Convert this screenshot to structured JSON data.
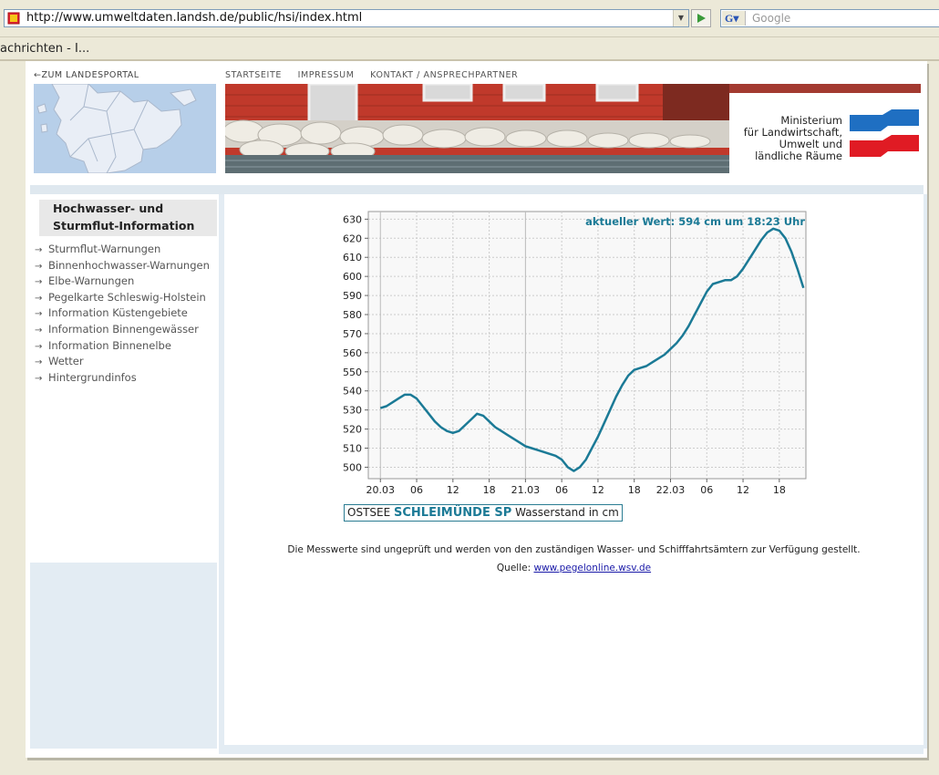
{
  "browser": {
    "url": "http://www.umweltdaten.landsh.de/public/hsi/index.html",
    "search_placeholder": "Google",
    "search_engine_icon": "G",
    "tab_title": "achrichten - I..."
  },
  "header": {
    "back_link": "ZUM LANDESPORTAL",
    "nav": [
      "STARTSEITE",
      "IMPRESSUM",
      "KONTAKT / ANSPRECHPARTNER"
    ],
    "ministry_lines": [
      "Ministerium",
      "für Landwirtschaft,",
      "Umwelt und",
      "ländliche Räume"
    ]
  },
  "sidebar": {
    "title_lines": [
      "Hochwasser- und",
      "Sturmflut-Information"
    ],
    "items": [
      "Sturmflut-Warnungen",
      "Binnenhochwasser-Warnungen",
      "Elbe-Warnungen",
      "Pegelkarte Schleswig-Holstein",
      "Information Küstengebiete",
      "Information Binnengewässer",
      "Information Binnenelbe",
      "Wetter",
      "Hintergrundinfos"
    ]
  },
  "chart_data": {
    "type": "line",
    "annotation": "aktueller Wert: 594 cm um 18:23 Uhr",
    "ylim": [
      494,
      634
    ],
    "yticks": [
      500,
      510,
      520,
      530,
      540,
      550,
      560,
      570,
      580,
      590,
      600,
      610,
      620,
      630
    ],
    "xlim": [
      -2,
      70.4
    ],
    "xticks": [
      {
        "x": 0,
        "label": "20.03"
      },
      {
        "x": 6,
        "label": "06"
      },
      {
        "x": 12,
        "label": "12"
      },
      {
        "x": 18,
        "label": "18"
      },
      {
        "x": 24,
        "label": "21.03"
      },
      {
        "x": 30,
        "label": "06"
      },
      {
        "x": 36,
        "label": "12"
      },
      {
        "x": 42,
        "label": "18"
      },
      {
        "x": 48,
        "label": "22.03"
      },
      {
        "x": 54,
        "label": "06"
      },
      {
        "x": 60,
        "label": "12"
      },
      {
        "x": 66,
        "label": "18"
      }
    ],
    "grid": true,
    "series": [
      {
        "color": "#1b7a96",
        "x": [
          0,
          1,
          2,
          3,
          4,
          5,
          6,
          7,
          8,
          9,
          10,
          11,
          12,
          13,
          14,
          15,
          16,
          17,
          18,
          19,
          20,
          21,
          22,
          23,
          24,
          25,
          26,
          27,
          28,
          29,
          30,
          31,
          32,
          33,
          34,
          35,
          36,
          37,
          38,
          39,
          40,
          41,
          42,
          43,
          44,
          45,
          46,
          47,
          48,
          49,
          50,
          51,
          52,
          53,
          54,
          55,
          56,
          57,
          58,
          59,
          60,
          61,
          62,
          63,
          64,
          65,
          66,
          67,
          68,
          69,
          70
        ],
        "y": [
          531,
          532,
          534,
          536,
          538,
          538,
          536,
          532,
          528,
          524,
          521,
          519,
          518,
          519,
          522,
          525,
          528,
          527,
          524,
          521,
          519,
          517,
          515,
          513,
          511,
          510,
          509,
          508,
          507,
          506,
          504,
          500,
          498,
          500,
          504,
          510,
          516,
          523,
          530,
          537,
          543,
          548,
          551,
          552,
          553,
          555,
          557,
          559,
          562,
          565,
          569,
          574,
          580,
          586,
          592,
          596,
          597,
          598,
          598,
          600,
          604,
          609,
          614,
          619,
          623,
          625,
          624,
          620,
          613,
          604,
          594
        ]
      }
    ]
  },
  "caption": {
    "prefix": "OSTSEE",
    "station": "SCHLEIMÜNDE SP",
    "suffix": "Wasserstand in cm"
  },
  "footer": {
    "note": "Die Messwerte sind ungeprüft und werden von den zuständigen Wasser- und Schifffahrtsämtern zur Verfügung gestellt.",
    "source_label": "Quelle:",
    "source_link": "www.pegelonline.wsv.de"
  }
}
